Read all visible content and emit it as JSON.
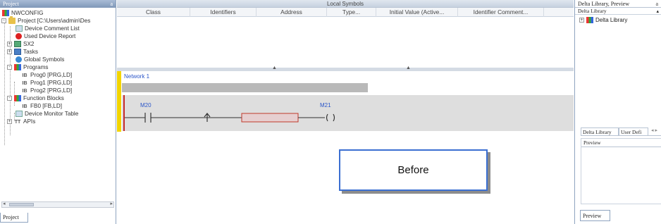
{
  "project_panel": {
    "title": "Project",
    "pin_glyph": "a",
    "tree": [
      {
        "label": "NWCONFIG",
        "icon": "network-icon",
        "expander": ""
      },
      {
        "label": "Project [C:\\Users\\admin\\Des",
        "icon": "project-icon",
        "expander": "-"
      },
      {
        "label": "Device Comment List",
        "icon": "comment-list-icon",
        "expander": ""
      },
      {
        "label": "Used Device Report",
        "icon": "report-icon",
        "expander": ""
      },
      {
        "label": "SX2",
        "icon": "device-icon",
        "expander": "+"
      },
      {
        "label": "Tasks",
        "icon": "tasks-icon",
        "expander": "+"
      },
      {
        "label": "Global Symbols",
        "icon": "globe-icon",
        "expander": ""
      },
      {
        "label": "Programs",
        "icon": "programs-icon",
        "expander": "-"
      },
      {
        "label": "Prog0 [PRG,LD]",
        "icon": "prg-icon",
        "expander": ""
      },
      {
        "label": "Prog1 [PRG,LD]",
        "icon": "prg-icon",
        "expander": ""
      },
      {
        "label": "Prog2 [PRG,LD]",
        "icon": "prg-icon",
        "expander": ""
      },
      {
        "label": "Function Blocks",
        "icon": "function-blocks-icon",
        "expander": "-"
      },
      {
        "label": "FB0 [FB,LD]",
        "icon": "fb-icon",
        "expander": ""
      },
      {
        "label": "Device Monitor Table",
        "icon": "monitor-table-icon",
        "expander": ""
      },
      {
        "label": "APIs",
        "icon": "apis-icon",
        "expander": "+"
      }
    ],
    "bottom_tab": "Project"
  },
  "local_symbols": {
    "title": "Local Symbols",
    "columns": [
      "Class",
      "Identifiers",
      "Address",
      "Type...",
      "Initial Value (Active...",
      "Identifier Comment..."
    ]
  },
  "ladder": {
    "network_label": "Network 1",
    "contact_1_label": "M20",
    "coil_label": "M21",
    "overlay_label": "Before"
  },
  "right_panel": {
    "title": "Delta Library, Preview",
    "pin_glyph": "a",
    "sub_title": "Delta Library",
    "tree_item": "Delta Library",
    "tabs": [
      "Delta Library",
      "User Defi"
    ],
    "preview_title": "Preview",
    "bottom_tab": "Preview"
  },
  "colors": {
    "rung_bg": "#dedede",
    "margin_yellow": "#f2d400",
    "power_rail": "#c62828",
    "label_blue": "#2a55c9",
    "before_border": "#3b6fd1"
  }
}
